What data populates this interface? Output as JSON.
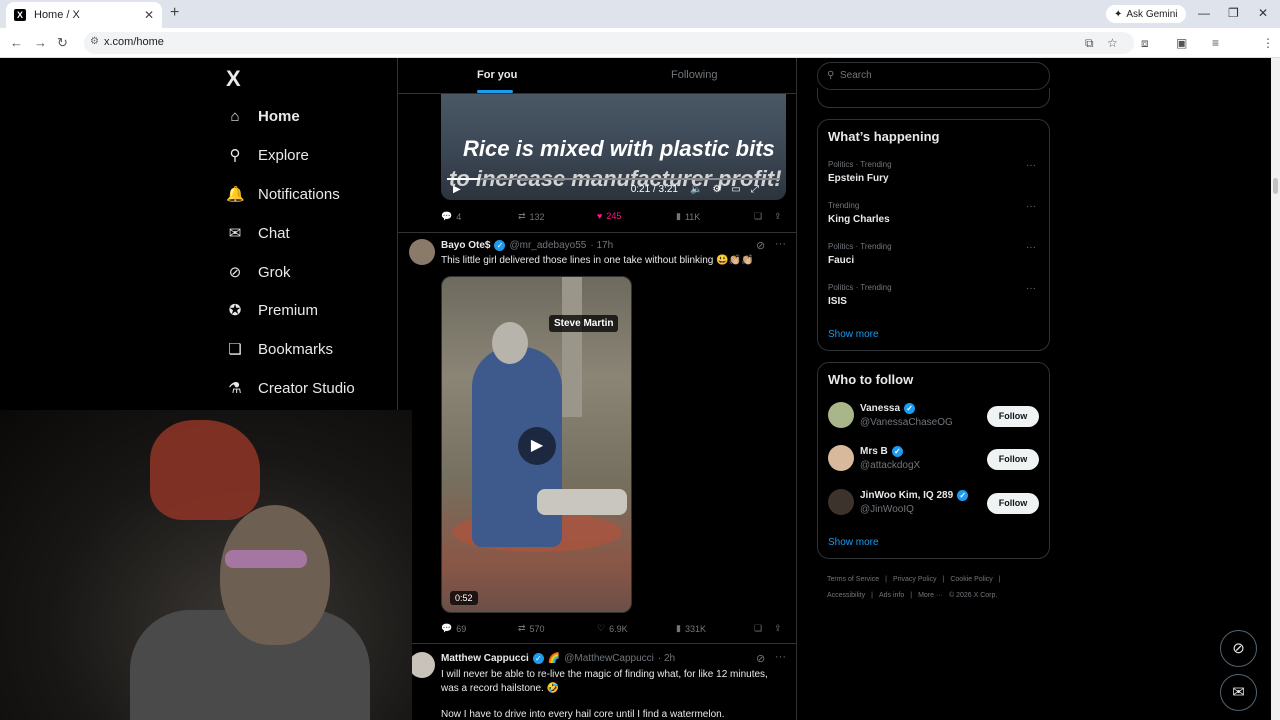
{
  "browser": {
    "tab_title": "Home / X",
    "tab_favicon": "X",
    "url": "x.com/home",
    "ask_gemini": "Ask Gemini"
  },
  "sidebar": {
    "logo": "X",
    "items": [
      {
        "label": "Home",
        "icon": "home-icon",
        "glyph": "⌂"
      },
      {
        "label": "Explore",
        "icon": "search-icon",
        "glyph": "⚲"
      },
      {
        "label": "Notifications",
        "icon": "bell-icon",
        "glyph": "🔔"
      },
      {
        "label": "Chat",
        "icon": "mail-icon",
        "glyph": "✉"
      },
      {
        "label": "Grok",
        "icon": "grok-icon",
        "glyph": "⊘"
      },
      {
        "label": "Premium",
        "icon": "verified-icon",
        "glyph": "✪"
      },
      {
        "label": "Bookmarks",
        "icon": "bookmark-icon",
        "glyph": "❏"
      },
      {
        "label": "Creator Studio",
        "icon": "flask-icon",
        "glyph": "⚗"
      }
    ]
  },
  "feed": {
    "tabs": [
      "For you",
      "Following"
    ],
    "post1": {
      "caption_line1": "Rice is mixed with plastic bits",
      "caption_line2": "to increase manufacturer profit!",
      "video_time": "0:21 / 3:21",
      "replies": "4",
      "reposts": "132",
      "likes": "245",
      "views": "11K"
    },
    "post2": {
      "name": "Bayo Ote$",
      "handle": "@mr_adebayo55",
      "time": "· 17h",
      "text": "This little girl delivered those lines in one take without blinking 😃👏🏼👏🏼",
      "video_label": "Steve Martin",
      "duration": "0:52",
      "replies": "69",
      "reposts": "570",
      "likes": "6.9K",
      "views": "331K"
    },
    "post3": {
      "name": "Matthew Cappucci",
      "handle": "@MatthewCappucci",
      "time": "· 2h",
      "text1": "I will never be able to re-live the magic of finding what, for like 12 minutes, was a record hailstone. 🤣",
      "text2": "Now I have to drive into every hail core until I find a watermelon."
    }
  },
  "right": {
    "search_placeholder": "Search",
    "happening_title": "What’s happening",
    "trends": [
      {
        "category": "Politics · Trending",
        "name": "Epstein Fury"
      },
      {
        "category": "Trending",
        "name": "King Charles"
      },
      {
        "category": "Politics · Trending",
        "name": "Fauci"
      },
      {
        "category": "Politics · Trending",
        "name": "ISIS"
      }
    ],
    "show_more": "Show more",
    "wtf_title": "Who to follow",
    "follow_label": "Follow",
    "suggestions": [
      {
        "name": "Vanessa",
        "handle": "@VanessaChaseOG"
      },
      {
        "name": "Mrs B",
        "handle": "@attackdogX"
      },
      {
        "name": "JinWoo Kim, IQ 289",
        "handle": "@JinWooIQ"
      }
    ],
    "footer": [
      "Terms of Service",
      "|",
      "Privacy Policy",
      "|",
      "Cookie Policy",
      "|",
      "Accessibility",
      "|",
      "Ads info",
      "|",
      "More ···",
      "© 2026 X Corp."
    ]
  },
  "colors": {
    "accent": "#1d9bf0",
    "like": "#f91880",
    "background": "#000000"
  }
}
